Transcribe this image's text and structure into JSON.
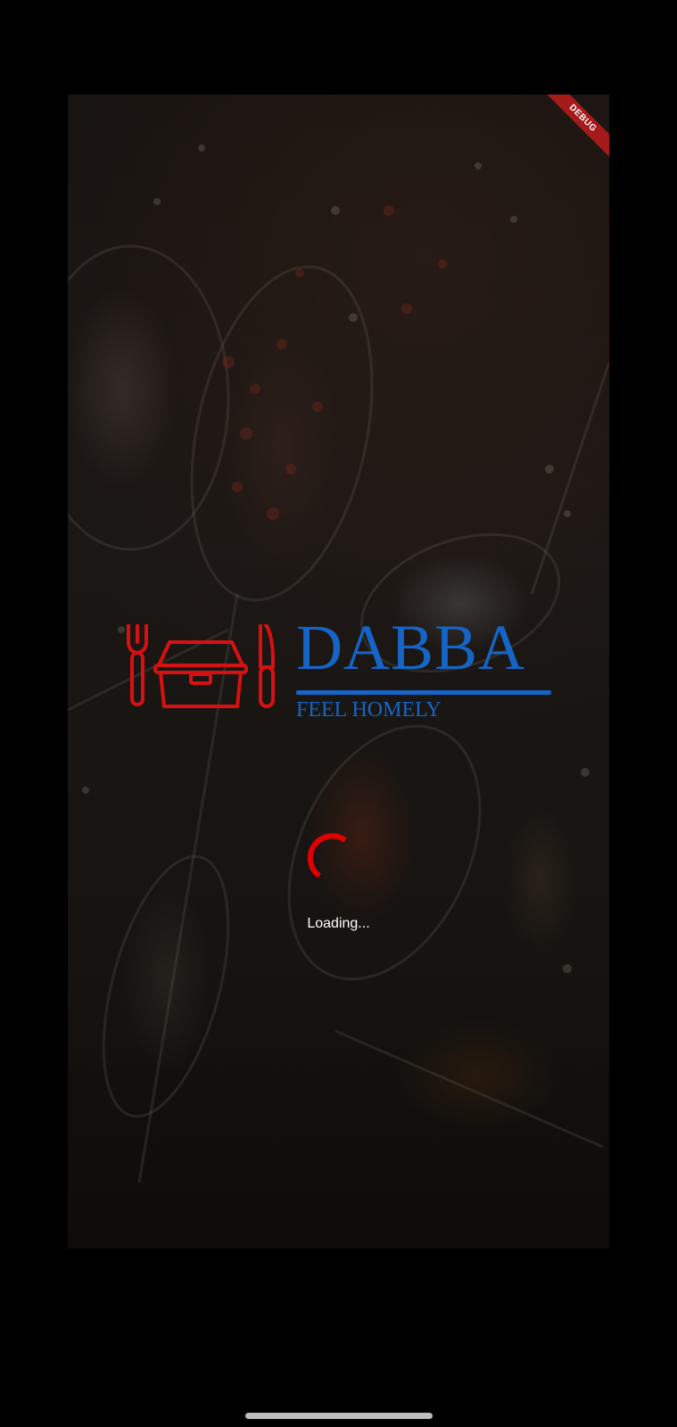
{
  "debug_banner": {
    "label": "DEBUG"
  },
  "logo": {
    "brand": "DABBA",
    "tagline": "FEEL HOMELY",
    "icon_color": "#d71111",
    "text_color": "#1565c8"
  },
  "loading": {
    "text": "Loading...",
    "spinner_color": "#e00000"
  },
  "icons": [
    "fork-icon",
    "lunchbox-icon",
    "knife-icon"
  ]
}
